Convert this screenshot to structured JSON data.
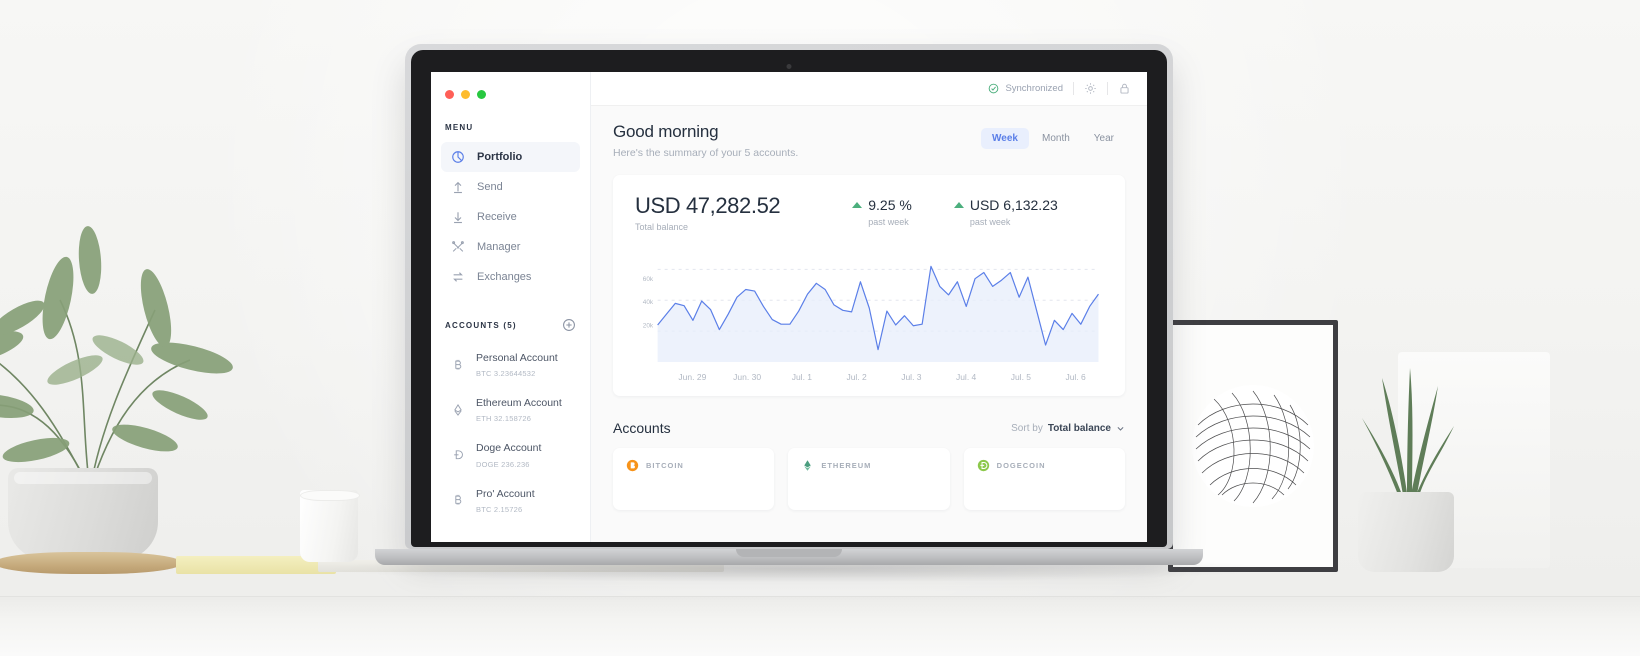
{
  "window": {
    "traffic_lights": [
      "close",
      "minimize",
      "maximize"
    ]
  },
  "sidebar": {
    "menu_label": "MENU",
    "nav": [
      {
        "label": "Portfolio",
        "icon": "pie-chart-icon",
        "active": true
      },
      {
        "label": "Send",
        "icon": "arrow-up-icon",
        "active": false
      },
      {
        "label": "Receive",
        "icon": "arrow-down-icon",
        "active": false
      },
      {
        "label": "Manager",
        "icon": "tools-icon",
        "active": false
      },
      {
        "label": "Exchanges",
        "icon": "swap-icon",
        "active": false
      }
    ],
    "accounts_label": "ACCOUNTS (5)",
    "add_account_icon": "plus-circle-icon",
    "accounts": [
      {
        "name": "Personal Account",
        "balance": "BTC 3.23644532",
        "icon": "bitcoin-icon"
      },
      {
        "name": "Ethereum Account",
        "balance": "ETH 32.158726",
        "icon": "ethereum-icon"
      },
      {
        "name": "Doge Account",
        "balance": "DOGE 236.236",
        "icon": "dogecoin-icon"
      },
      {
        "name": "Pro' Account",
        "balance": "BTC 2.15726",
        "icon": "bitcoin-icon"
      }
    ]
  },
  "topbar": {
    "sync_status": "Synchronized",
    "sync_icon": "check-circle-icon",
    "settings_icon": "gear-icon",
    "lock_icon": "lock-icon",
    "sync_color": "#4caf7d"
  },
  "header": {
    "greeting": "Good morning",
    "subtitle": "Here's the summary of your 5 accounts.",
    "periods": [
      {
        "label": "Week",
        "active": true
      },
      {
        "label": "Month",
        "active": false
      },
      {
        "label": "Year",
        "active": false
      }
    ],
    "accent_color": "#5b7fe8"
  },
  "balance": {
    "amount": "USD 47,282.52",
    "label": "Total balance",
    "stats": [
      {
        "value": "9.25 %",
        "sub": "past week",
        "direction": "up",
        "color": "#4caf7d"
      },
      {
        "value": "USD 6,132.23",
        "sub": "past week",
        "direction": "up",
        "color": "#4caf7d"
      }
    ]
  },
  "chart_data": {
    "type": "area",
    "title": "",
    "xlabel": "",
    "ylabel": "",
    "ylim": [
      0,
      70000
    ],
    "yticks": [
      20000,
      40000,
      60000
    ],
    "ytick_labels": [
      "20k",
      "40k",
      "60k"
    ],
    "grid": true,
    "legend": false,
    "line_color": "#5b7fe8",
    "fill_color": "#e7edfb",
    "categories": [
      "Jun. 29",
      "Jun. 30",
      "Jul. 1",
      "Jul. 2",
      "Jul. 3",
      "Jul. 4",
      "Jul. 5",
      "Jul. 6"
    ],
    "values": [
      24000,
      31000,
      38000,
      36500,
      27000,
      39500,
      34000,
      21000,
      31000,
      42000,
      47000,
      46000,
      36000,
      27500,
      24500,
      24500,
      33000,
      44000,
      51000,
      47000,
      37000,
      33500,
      32500,
      52000,
      35000,
      8000,
      33000,
      24000,
      30000,
      23500,
      24500,
      62000,
      49000,
      43500,
      52000,
      36000,
      54000,
      58000,
      49000,
      53000,
      58000,
      42000,
      55000,
      33000,
      11000,
      27000,
      21000,
      31500,
      24500,
      36000,
      44000
    ]
  },
  "accounts_section": {
    "title": "Accounts",
    "sort_prefix": "Sort by",
    "sort_value": "Total balance",
    "sort_icon": "chevron-down-icon",
    "cards": [
      {
        "name": "BITCOIN",
        "icon": "bitcoin-coin-icon",
        "color": "#f7931a"
      },
      {
        "name": "ETHEREUM",
        "icon": "ethereum-coin-icon",
        "color": "#4b9e7f"
      },
      {
        "name": "DOGECOIN",
        "icon": "dogecoin-coin-icon",
        "color": "#8cc84b"
      }
    ]
  }
}
